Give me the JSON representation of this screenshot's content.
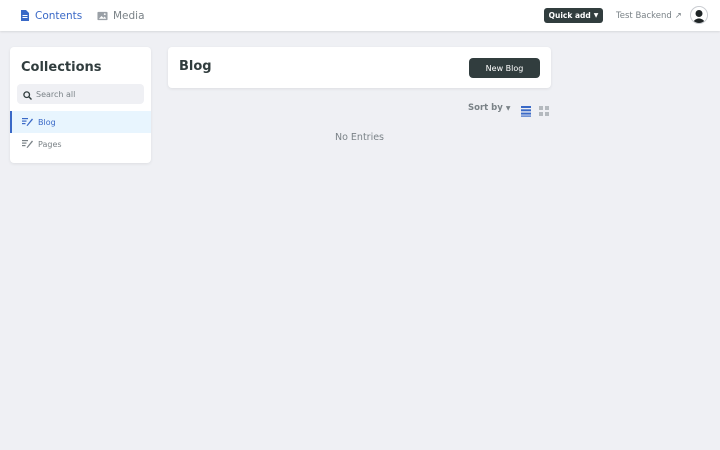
{
  "topbar": {
    "contents_label": "Contents",
    "media_label": "Media",
    "quick_add_label": "Quick add",
    "backend_label": "Test Backend",
    "backend_arrow": "↗"
  },
  "sidebar": {
    "title": "Collections",
    "search_placeholder": "Search all",
    "items": [
      {
        "label": "Blog",
        "active": true
      },
      {
        "label": "Pages",
        "active": false
      }
    ]
  },
  "main": {
    "title": "Blog",
    "new_button_label": "New Blog",
    "sort_label": "Sort by",
    "view_mode": "list",
    "empty_text": "No Entries"
  },
  "colors": {
    "accent": "#3a69c7",
    "dark": "#313d3e",
    "muted": "#7a8287",
    "background": "#eff0f4",
    "active_item_bg": "#e8f5fe"
  },
  "icons": {
    "contents": "document-icon",
    "media": "image-icon",
    "search": "search-icon",
    "collection": "write-icon",
    "list_view": "list-view-icon",
    "grid_view": "grid-view-icon",
    "avatar": "user-avatar-icon"
  }
}
